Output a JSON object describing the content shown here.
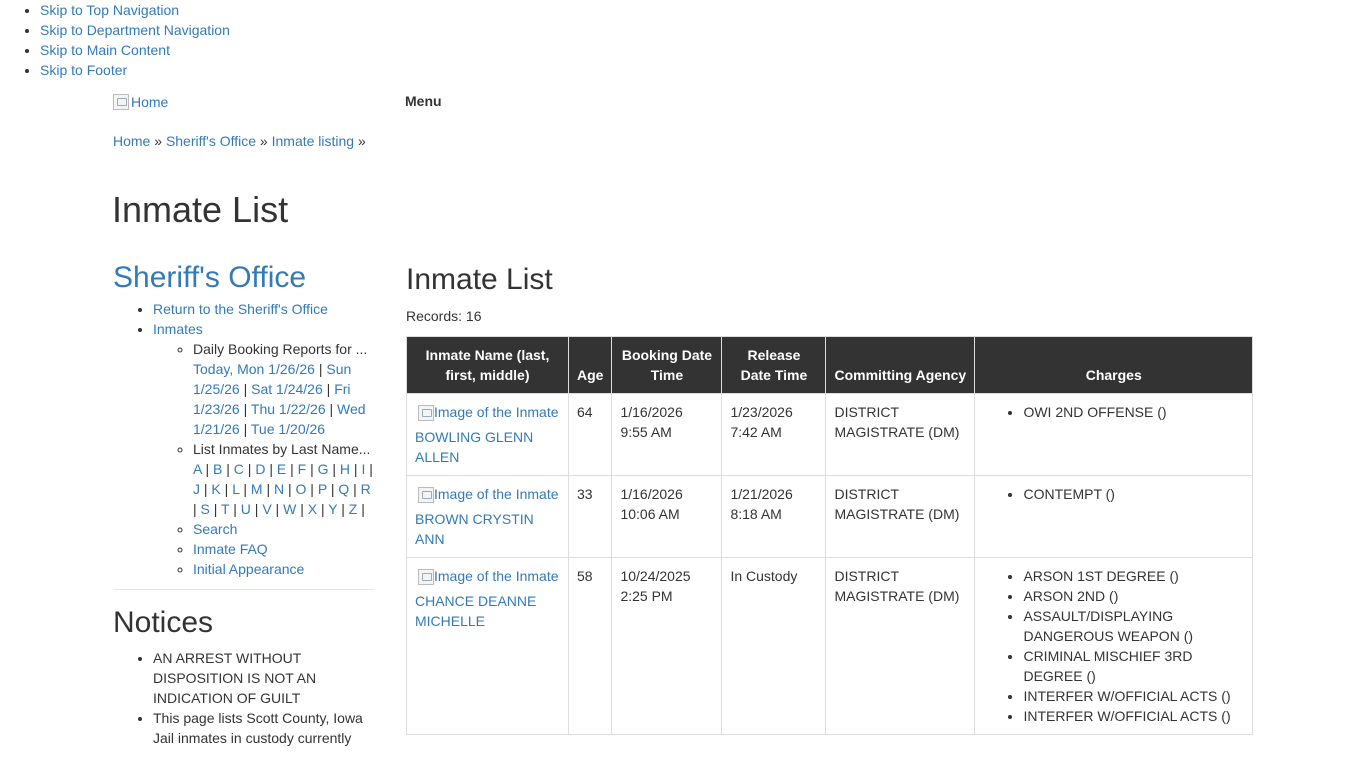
{
  "skip_links": [
    "Skip to Top Navigation",
    "Skip to Department Navigation",
    "Skip to Main Content",
    "Skip to Footer"
  ],
  "header": {
    "logo_alt": "Home",
    "menu_label": "Menu"
  },
  "breadcrumb": {
    "items": [
      "Home",
      "Sheriff's Office",
      "Inmate listing"
    ],
    "sep": "»"
  },
  "page_title": "Inmate List",
  "sidebar": {
    "title": "Sheriff's Office",
    "return_link": "Return to the Sheriff's Office",
    "inmates_link": "Inmates",
    "daily_label": "Daily Booking Reports for ...",
    "daily_links": [
      "Today, Mon 1/26/26",
      "Sun 1/25/26",
      "Sat 1/24/26",
      "Fri 1/23/26",
      "Thu 1/22/26",
      "Wed 1/21/26",
      "Tue 1/20/26"
    ],
    "by_name_label": "List Inmates by Last Name...",
    "letters": [
      "A",
      "B",
      "C",
      "D",
      "E",
      "F",
      "G",
      "H",
      "I",
      "J",
      "K",
      "L",
      "M",
      "N",
      "O",
      "P",
      "Q",
      "R",
      "S",
      "T",
      "U",
      "V",
      "W",
      "X",
      "Y",
      "Z"
    ],
    "search": "Search",
    "faq": "Inmate FAQ",
    "initial": "Initial Appearance"
  },
  "notices": {
    "title": "Notices",
    "items": [
      "AN ARREST WITHOUT DISPOSITION IS NOT AN INDICATION OF GUILT",
      "This page lists Scott County, Iowa Jail inmates in custody currently"
    ]
  },
  "main": {
    "title": "Inmate List",
    "records_label": "Records:",
    "records_count": "16",
    "columns": [
      "Inmate Name (last, first, middle)",
      "Age",
      "Booking Date Time",
      "Release Date Time",
      "Committing Agency",
      "Charges"
    ],
    "image_alt": "Image of the Inmate",
    "rows": [
      {
        "name": "BOWLING GLENN ALLEN",
        "age": "64",
        "booking": "1/16/2026 9:55 AM",
        "release": "1/23/2026 7:42 AM",
        "agency": "DISTRICT MAGISTRATE (DM)",
        "charges": [
          "OWI 2ND OFFENSE ()"
        ]
      },
      {
        "name": "BROWN CRYSTIN ANN",
        "age": "33",
        "booking": "1/16/2026 10:06 AM",
        "release": "1/21/2026 8:18 AM",
        "agency": "DISTRICT MAGISTRATE (DM)",
        "charges": [
          "CONTEMPT ()"
        ]
      },
      {
        "name": "CHANCE DEANNE MICHELLE",
        "age": "58",
        "booking": "10/24/2025 2:25 PM",
        "release": "In Custody",
        "agency": "DISTRICT MAGISTRATE (DM)",
        "charges": [
          "ARSON 1ST DEGREE ()",
          "ARSON 2ND ()",
          "ASSAULT/DISPLAYING DANGEROUS WEAPON ()",
          "CRIMINAL MISCHIEF 3RD DEGREE ()",
          "INTERFER W/OFFICIAL ACTS ()",
          "INTERFER W/OFFICIAL ACTS ()"
        ]
      }
    ]
  }
}
